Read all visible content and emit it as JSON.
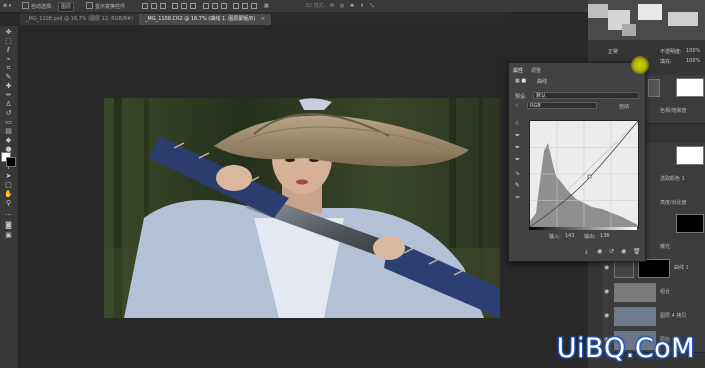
{
  "options_bar": {
    "auto_select_label": "自动选择:",
    "auto_select_value": "图层",
    "show_transform_label": "显示变换控件",
    "mode_3d_label": "3D 模式:"
  },
  "tabs": [
    {
      "label": "_MG_1108.psd @ 16.7% (图层 12, RGB/8#)",
      "close": "×"
    },
    {
      "label": "_MG_1108.CR2 @ 16.7% (曲线 1, 图层蒙版/8)",
      "close": "×"
    }
  ],
  "right_panel": {
    "opacity_label": "不透明度:",
    "opacity_value": "100%",
    "fill_label": "填充:",
    "fill_value": "100%",
    "blend_mode": "正常",
    "layers": [
      {
        "name": "曲线 1"
      },
      {
        "name": "组合"
      },
      {
        "name": "图层 4 拷贝"
      },
      {
        "name": "原始"
      }
    ],
    "adjustment_labels": [
      {
        "name": "色相/饱和度"
      },
      {
        "name": "选取颜色 1"
      },
      {
        "name": "亮度/对比度"
      },
      {
        "name": "曝光"
      }
    ]
  },
  "properties": {
    "tab_properties": "属性",
    "tab_adjust": "调整",
    "title": "曲线",
    "preset_label": "预设:",
    "preset_value": "默认",
    "channel_value": "RGB",
    "auto_button": "自动",
    "input_label": "输入:",
    "input_value": "143",
    "output_label": "输出:",
    "output_value": "136"
  },
  "colors": {
    "accent_cursor": "#b8c300",
    "watermark": "#2a62c9",
    "ui_dark": "#282828",
    "panel": "#424242"
  },
  "icons": [
    "move-icon",
    "marquee-icon",
    "lasso-icon",
    "quick-select-icon",
    "crop-icon",
    "eyedropper-icon",
    "healing-icon",
    "brush-icon",
    "stamp-icon",
    "history-brush-icon",
    "eraser-icon",
    "gradient-icon",
    "blur-icon",
    "dodge-icon",
    "pen-icon",
    "type-icon",
    "path-select-icon",
    "rectangle-icon",
    "hand-icon",
    "zoom-icon",
    "eye-icon",
    "trash-icon"
  ],
  "watermark": {
    "text": "UiBQ.CoM"
  }
}
